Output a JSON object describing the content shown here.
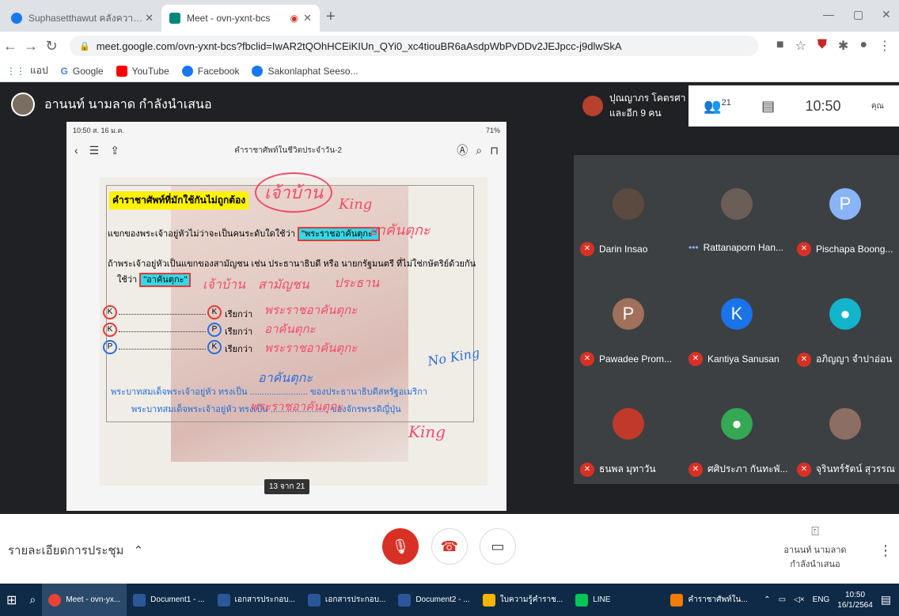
{
  "browser": {
    "tabs": [
      {
        "label": "Suphasetthawut คลังความรู้สุขสันต์",
        "active": false
      },
      {
        "label": "Meet - ovn-yxnt-bcs",
        "active": true
      }
    ],
    "url": "meet.google.com/ovn-yxnt-bcs?fbclid=IwAR2tQOhHCEiKIUn_QYi0_xc4tiouBR6aAsdpWbPvDDv2JEJpcc-j9dlwSkA",
    "bookmarks": [
      "แอป",
      "Google",
      "YouTube",
      "Facebook",
      "Sakonlaphat Seeso..."
    ]
  },
  "meet": {
    "presenter_text": "อานนท์ นามลาด กำลังนำเสนอ",
    "chat_preview": {
      "name": "ปุณญาภร โคตรศา",
      "others": "และอีก 9 คน"
    },
    "people_count": "21",
    "time": "10:50",
    "self_label": "คุณ",
    "shared_screen": {
      "status_left": "10:50  ส. 16 ม.ค.",
      "status_right": "71%",
      "doc_title": "คำราชาศัพท์ในชีวิตประจำวัน-2",
      "heading": "คำราชาศัพท์ที่มักใช้กันไม่ถูกต้อง",
      "line1": "แขกของพระเจ้าอยู่หัวไม่ว่าจะเป็นคนระดับใดใช้ว่า",
      "line1_highlight": "\"พระราชอาคันตุกะ\"",
      "line2": "ถ้าพระเจ้าอยู่หัวเป็นแขกของสามัญชน เช่น ประธานาธิบดี หรือ นายกรัฐมนตรี ที่ไม่ใช่กษัตริย์ด้วยกัน",
      "line3_prefix": "ใช้ว่า",
      "line3_highlight": "\"อาคันตุกะ\"",
      "rows": [
        {
          "left": "K",
          "right": "K",
          "label": "เรียกว่า"
        },
        {
          "left": "K",
          "right": "P",
          "label": "เรียกว่า"
        },
        {
          "left": "P",
          "right": "K",
          "label": "เรียกว่า"
        }
      ],
      "blue1": "พระบาทสมเด็จพระเจ้าอยู่หัว ทรงเป็น ........................ ของประธานาธิบดีสหรัฐอเมริกา",
      "blue2": "พระบาทสมเด็จพระเจ้าอยู่หัว ทรงเป็น ........................ ของจักรพรรดิญี่ปุ่น",
      "ink": {
        "top_circle": "เจ้าบ้าน",
        "king1": "King",
        "akhantuka1": "อาคันตุกะ",
        "phuen_ban": "เจ้าบ้าน",
        "saman": "สามัญชน",
        "prathan": "ประธาน",
        "row1": "พระราชอาคันตุกะ",
        "row2": "อาคันตุกะ",
        "row3": "พระราชอาคันตุกะ",
        "noking": "No King",
        "blank1": "อาคันตุกะ",
        "blank2": "พระราชอาคันตุกะ",
        "king2": "King"
      },
      "page_indicator": "13 จาก 21"
    },
    "participants": [
      {
        "name": "Darin Insao",
        "avatar": "photo",
        "color": "#5b4a3f",
        "muted": true
      },
      {
        "name": "Rattanaporn Han...",
        "avatar": "photo",
        "color": "#6b5e57",
        "muted": false
      },
      {
        "name": "Pischapa Boong...",
        "avatar": "P",
        "color": "#8ab4f8",
        "muted": true
      },
      {
        "name": "Pawadee Prom...",
        "avatar": "P",
        "color": "#a0705a",
        "muted": true
      },
      {
        "name": "Kantiya Sanusan",
        "avatar": "K",
        "color": "#1a73e8",
        "muted": true
      },
      {
        "name": "อภิญญา จำปาอ่อน",
        "avatar": "person",
        "color": "#12b5cb",
        "muted": true
      },
      {
        "name": "ธนพล มุทาวัน",
        "avatar": "photo",
        "color": "#c0392b",
        "muted": true
      },
      {
        "name": "ศศิประภา กันทะพั...",
        "avatar": "person",
        "color": "#34a853",
        "muted": true
      },
      {
        "name": "จุรินทร์รัตน์ สุวรรณรัตน์",
        "avatar": "photo",
        "color": "#8d6e63",
        "muted": true
      }
    ],
    "controls": {
      "details": "รายละเอียดการประชุม",
      "present_line1": "อานนท์ นามลาด",
      "present_line2": "กำลังนำเสนอ"
    }
  },
  "taskbar": {
    "items": [
      {
        "label": "Meet - ovn-yx...",
        "color": "#ea4335",
        "active": true
      },
      {
        "label": "Document1 - ...",
        "color": "#2b579a",
        "active": false
      },
      {
        "label": "เอกสารประกอบ...",
        "color": "#2b579a",
        "active": false
      },
      {
        "label": "เอกสารประกอบ...",
        "color": "#2b579a",
        "active": false
      },
      {
        "label": "Document2 - ...",
        "color": "#2b579a",
        "active": false
      },
      {
        "label": "ใบความรู้คำราช...",
        "color": "#f4b400",
        "active": false
      },
      {
        "label": "LINE",
        "color": "#06c755",
        "active": false
      },
      {
        "label": "คำราชาศัพท์ใน...",
        "color": "#f57c00",
        "active": false
      }
    ],
    "lang": "ENG",
    "time": "10:50",
    "date": "16/1/2564"
  }
}
